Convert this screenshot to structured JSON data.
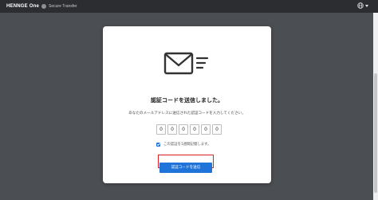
{
  "topbar": {
    "brand": "HENNGE One",
    "product": "Secure Transfer",
    "icons": {
      "language": "globe-icon",
      "dropdown": "chevron-down-icon"
    }
  },
  "dialog": {
    "icon": "mail-sent-icon",
    "title": "認証コードを送信しました。",
    "description": "あなたのメールアドレスに送信された認証コードを入力してください。",
    "code_digits": [
      "0",
      "0",
      "0",
      "0",
      "0",
      "0"
    ],
    "remember_label": "この認証を1週間記憶します。",
    "remember_checked": true,
    "submit_label": "認証コードを送信"
  },
  "colors": {
    "topbar": "#2b2d31",
    "background": "#4b4e53",
    "accent": "#1f73d9",
    "highlight_border": "#e02020"
  }
}
